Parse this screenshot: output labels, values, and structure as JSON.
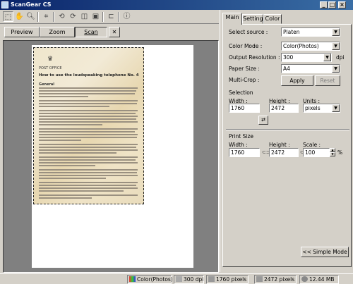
{
  "window": {
    "title": "ScanGear CS",
    "minimize": "_",
    "maximize": "□",
    "close": "×"
  },
  "toolbar": {
    "tools": [
      "select-frame-tool",
      "hand-tool",
      "zoom-tool",
      "auto-crop-tool",
      "rotate-left-tool",
      "rotate-right-tool",
      "mirror-tool",
      "clear-tool",
      "flip-tool",
      "info-tool"
    ]
  },
  "preview_bar": {
    "preview_label": "Preview",
    "zoom_label": "Zoom",
    "scan_label": "Scan",
    "close_label": "✕"
  },
  "document": {
    "header": "POST OFFICE",
    "title": "How to use the loudspeaking telephone No. 4",
    "section": "General"
  },
  "tabs": [
    {
      "label": "Main"
    },
    {
      "label": "Settings"
    },
    {
      "label": "Color"
    }
  ],
  "main_tab": {
    "select_source_label": "Select source :",
    "select_source_value": "Platen",
    "color_mode_label": "Color Mode :",
    "color_mode_value": "Color(Photos)",
    "output_resolution_label": "Output Resolution :",
    "output_resolution_value": "300",
    "dpi_unit": "dpi",
    "paper_size_label": "Paper Size :",
    "paper_size_value": "A4",
    "multi_crop_label": "Multi-Crop :",
    "apply_label": "Apply",
    "reset_label": "Reset",
    "selection_label": "Selection",
    "width_label": "Width :",
    "height_label": "Height :",
    "units_label": "Units :",
    "selection_width": "1760",
    "selection_height": "2472",
    "units_value": "pixels",
    "print_size_label": "Print Size",
    "print_width_label": "Width :",
    "print_height_label": "Height :",
    "scale_label": "Scale :",
    "print_width": "1760",
    "print_height": "2472",
    "scale_value": "100",
    "scale_unit": "%",
    "simple_mode_label": "<< Simple Mode"
  },
  "status": {
    "color_mode": "Color(Photos)",
    "resolution": "300 dpi",
    "width": "1760 pixels",
    "height": "2472 pixels",
    "file_size": "12.44 MB"
  },
  "colors": {
    "titlebar_start": "#0a246a",
    "titlebar_end": "#3a6ea5",
    "face": "#d4d0c8",
    "preview_bg": "#808080"
  }
}
